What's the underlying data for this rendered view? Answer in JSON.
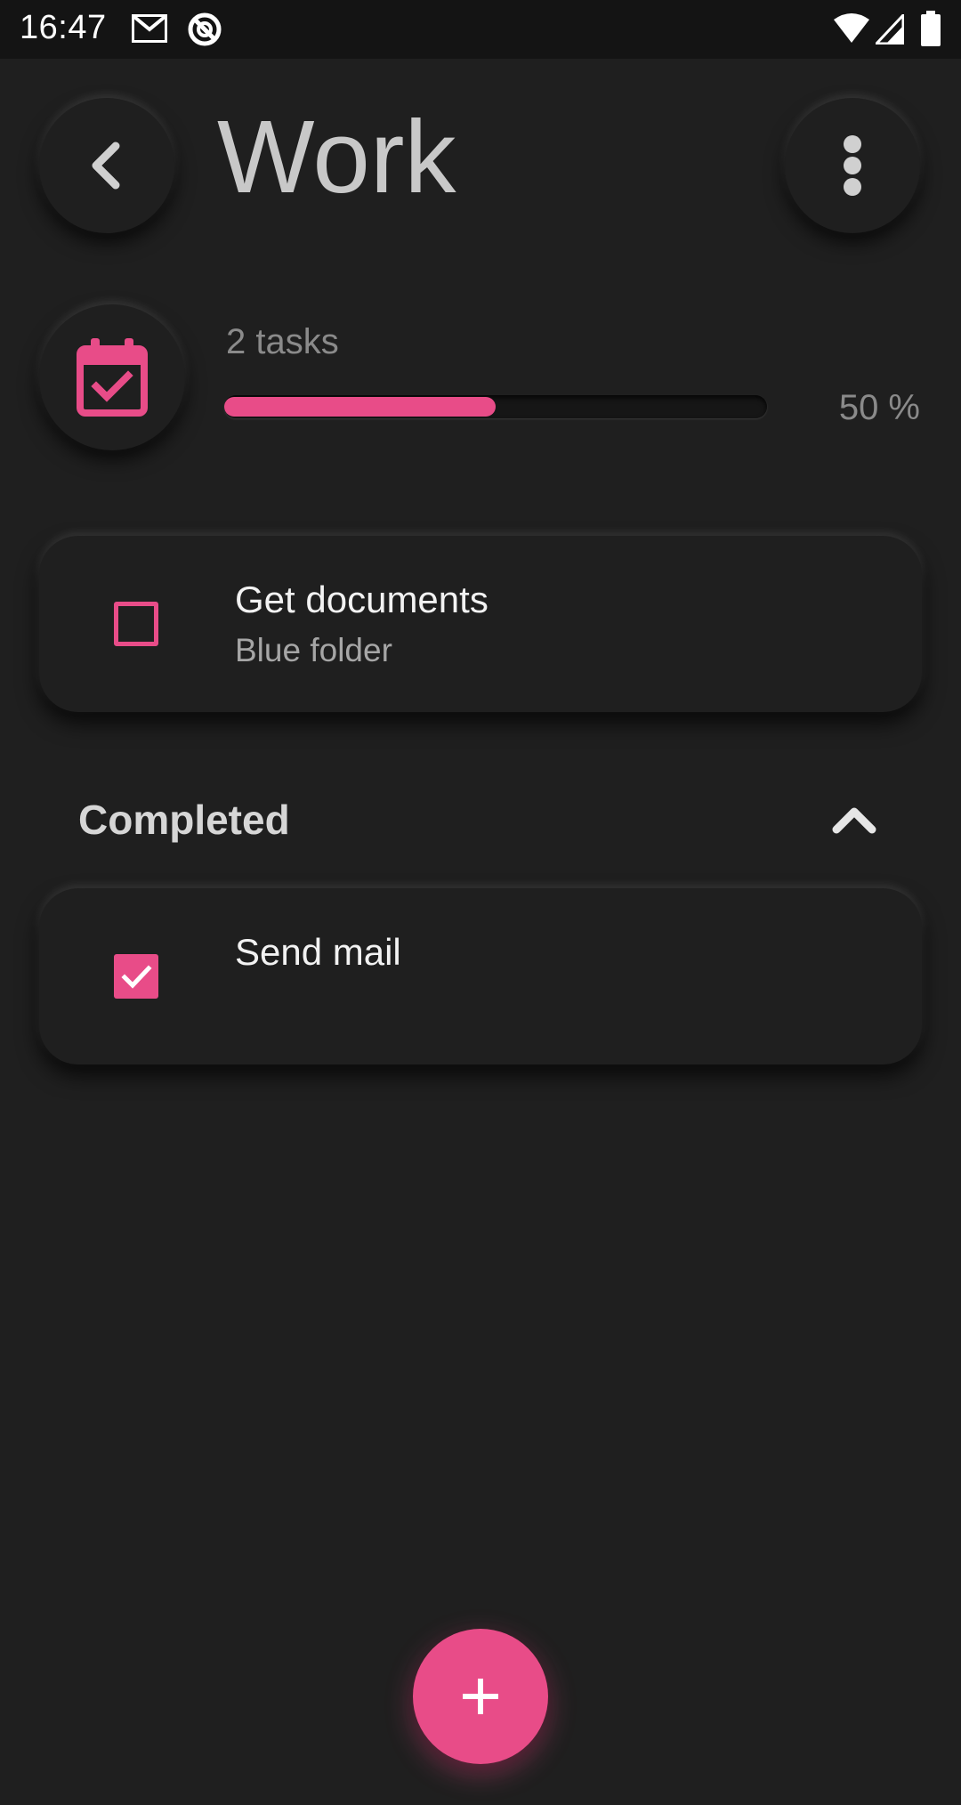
{
  "status_bar": {
    "time": "16:47",
    "icons": [
      "gmail-icon",
      "sync-icon",
      "wifi-icon",
      "signal-icon",
      "battery-icon"
    ]
  },
  "header": {
    "title": "Work",
    "back_icon": "chevron-left-icon",
    "menu_icon": "more-vertical-icon"
  },
  "summary": {
    "category_icon": "calendar-check-icon",
    "tasks_label": "2 tasks",
    "progress_label": "50 %",
    "progress_fraction": 0.5
  },
  "tasks": [
    {
      "title": "Get documents",
      "subtitle": "Blue folder",
      "done": false
    }
  ],
  "completed": {
    "header": "Completed",
    "toggle_icon": "chevron-up-icon",
    "tasks": [
      {
        "title": "Send mail",
        "done": true
      }
    ]
  },
  "fab": {
    "icon": "plus-icon"
  },
  "colors": {
    "accent": "#e84c88",
    "background": "#1f1f1f",
    "status_bar": "#141414"
  }
}
